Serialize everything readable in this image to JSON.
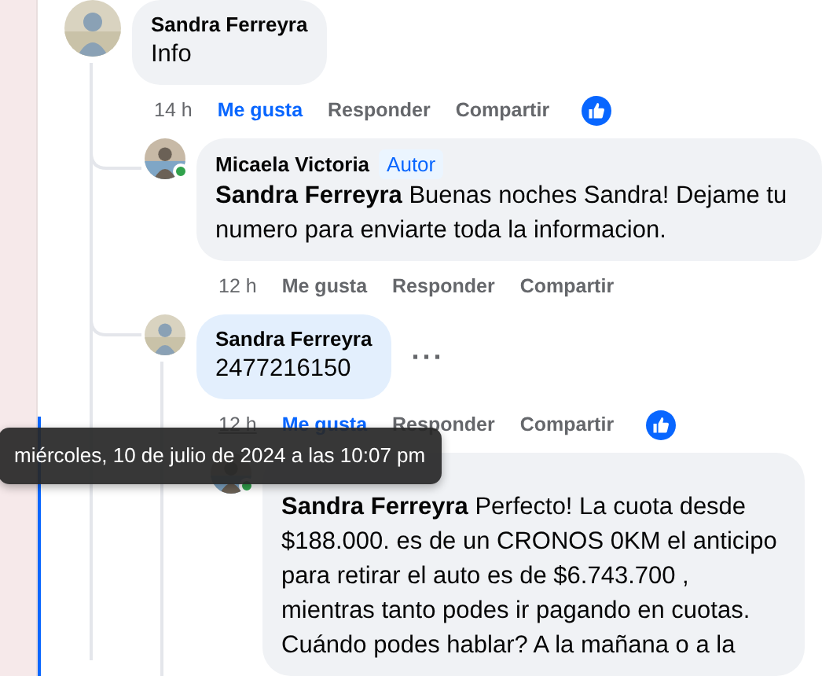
{
  "comments": [
    {
      "author": "Sandra Ferreyra",
      "text": "Info",
      "highlighted": false,
      "time": "14 h",
      "time_hovered": false,
      "actions": [
        {
          "label": "Me gusta",
          "selected": true
        },
        {
          "label": "Responder",
          "selected": false
        },
        {
          "label": "Compartir",
          "selected": false
        }
      ],
      "like_reaction": true,
      "replies": [
        {
          "author": "Micaela Victoria",
          "author_badge": "Autor",
          "text": "**Sandra Ferreyra** Buenas noches Sandra! Dejame tu numero para enviarte toda la informacion.",
          "online": true,
          "highlighted": false,
          "time": "12 h",
          "time_hovered": false,
          "actions": [
            {
              "label": "Me gusta",
              "selected": false
            },
            {
              "label": "Responder",
              "selected": false
            },
            {
              "label": "Compartir",
              "selected": false
            }
          ]
        },
        {
          "author": "Sandra Ferreyra",
          "text": "2477216150",
          "highlighted": true,
          "more_button": "···",
          "time": "12 h",
          "time_hovered": true,
          "actions": [
            {
              "label": "Me gusta",
              "selected": true
            },
            {
              "label": "Responder",
              "selected": false
            },
            {
              "label": "Compartir",
              "selected": false
            }
          ],
          "like_reaction": true,
          "replies": [
            {
              "text": "**Sandra Ferreyra** Perfecto! La cuota desde $188.000. es de un CRONOS 0KM el anticipo para retirar el auto es de $6.743.700 , mientras tanto podes ir pagando en cuotas. Cuándo podes hablar? A la mañana o a la",
              "online": true,
              "highlighted": false
            }
          ]
        }
      ]
    }
  ],
  "tooltip": {
    "text": "miércoles, 10 de julio de 2024 a las 10:07 pm"
  }
}
